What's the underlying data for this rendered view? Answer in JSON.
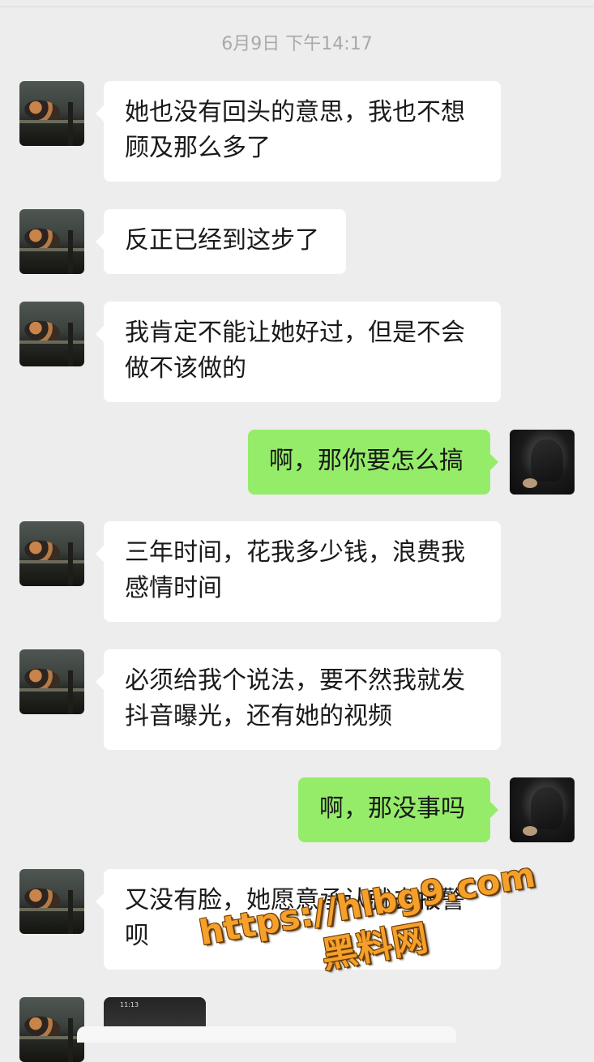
{
  "chat": {
    "timestamp": "6月9日 下午14:17",
    "messages": [
      {
        "sender": "other",
        "text": "她也没有回头的意思，我也不想顾及那么多了"
      },
      {
        "sender": "other",
        "text": "反正已经到这步了"
      },
      {
        "sender": "other",
        "text": "我肯定不能让她好过，但是不会做不该做的"
      },
      {
        "sender": "me",
        "text": "啊，那你要怎么搞"
      },
      {
        "sender": "other",
        "text": "三年时间，花我多少钱，浪费我感情时间"
      },
      {
        "sender": "other",
        "text": "必须给我个说法，要不然我就发抖音曝光，还有她的视频"
      },
      {
        "sender": "me",
        "text": "啊，那没事吗"
      },
      {
        "sender": "other",
        "text": "又没有脸，她愿意承认就去报警呗"
      }
    ],
    "partial_image_time": "11:13"
  },
  "watermark": {
    "url": "https://hlbg9.com",
    "name": "黑料网"
  },
  "colors": {
    "background": "#ededed",
    "incoming_bubble": "#ffffff",
    "outgoing_bubble": "#95ec69",
    "timestamp_text": "#a9a9a9",
    "watermark": "#f4a02b"
  }
}
